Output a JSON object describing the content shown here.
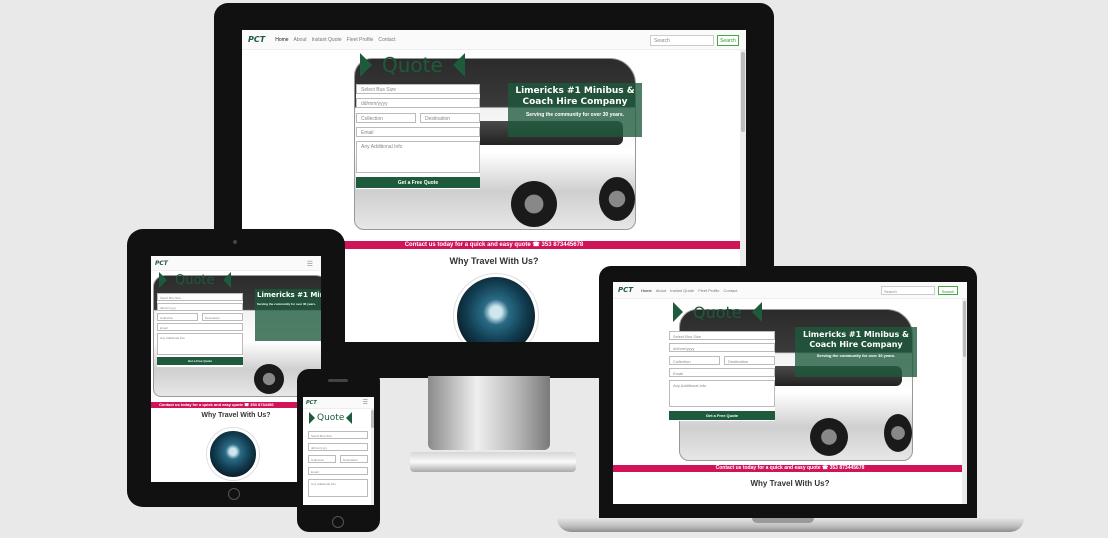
{
  "site": {
    "logo": "PCT",
    "nav": [
      "Home",
      "About",
      "Instant Quote",
      "Fleet Profile",
      "Contact"
    ],
    "search_placeholder": "Search",
    "search_button": "Search",
    "banner_title": "Limericks #1 Minibus & Coach Hire Company",
    "banner_sub": "Serving the community for over 30 years.",
    "quote_title": "Quote",
    "form": {
      "bus_size": "Select Bus Size",
      "date": "dd/mm/yyyy",
      "collection": "Collection",
      "destination": "Destination",
      "email": "Email",
      "info": "Any Additional Info",
      "submit": "Get a Free Quote"
    },
    "contact_strip": "Contact us today for a quick and easy quote ☎ 353 873445678",
    "why_title": "Why Travel With Us?"
  },
  "tablet_strip": "Contact us today for a quick and easy quote ☎ 353 8734456",
  "colors": {
    "brand": "#1e5a3c",
    "strip": "#d0145a"
  }
}
